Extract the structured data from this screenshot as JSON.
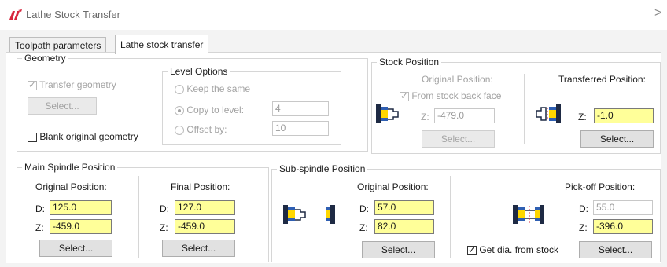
{
  "window": {
    "title": "Lathe Stock Transfer",
    "close_label": ">"
  },
  "tabs": [
    {
      "label": "Toolpath parameters"
    },
    {
      "label": "Lathe stock transfer"
    }
  ],
  "geometry": {
    "legend": "Geometry",
    "transfer_label": "Transfer geometry",
    "select_label": "Select...",
    "blank_label": "Blank original geometry"
  },
  "level_options": {
    "legend": "Level Options",
    "keep_label": "Keep the same",
    "copy_label": "Copy to level:",
    "copy_value": "4",
    "offset_label": "Offset by:",
    "offset_value": "10"
  },
  "stock_position": {
    "legend": "Stock Position",
    "original_label": "Original Position:",
    "from_back_label": "From stock back face",
    "z_label": "Z:",
    "z_value": "-479.0",
    "select_label": "Select...",
    "transferred_label": "Transferred Position:",
    "tz_label": "Z:",
    "tz_value": "-1.0",
    "tselect_label": "Select..."
  },
  "main_spindle": {
    "legend": "Main Spindle Position",
    "original_label": "Original Position:",
    "od_label": "D:",
    "od_value": "125.0",
    "oz_label": "Z:",
    "oz_value": "-459.0",
    "oselect_label": "Select...",
    "final_label": "Final Position:",
    "fd_label": "D:",
    "fd_value": "127.0",
    "fz_label": "Z:",
    "fz_value": "-459.0",
    "fselect_label": "Select..."
  },
  "sub_spindle": {
    "legend": "Sub-spindle Position",
    "original_label": "Original Position:",
    "d_label": "D:",
    "d_value": "57.0",
    "z_label": "Z:",
    "z_value": "82.0",
    "select_label": "Select...",
    "pickoff_label": "Pick-off  Position:",
    "pd_label": "D:",
    "pd_value": "55.0",
    "pz_label": "Z:",
    "pz_value": "-396.0",
    "get_dia_label": "Get dia. from stock",
    "pselect_label": "Select..."
  },
  "colors": {
    "highlight_field": "#ffff99",
    "logo_red": "#d7263d"
  }
}
